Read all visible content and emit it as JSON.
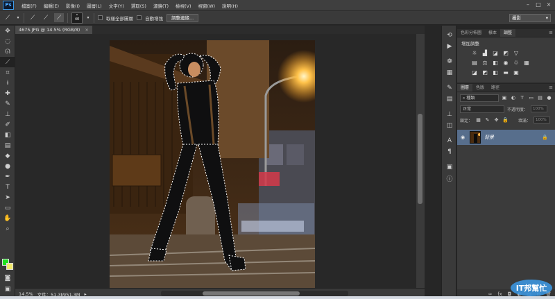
{
  "app": {
    "logo": "Ps"
  },
  "menu": [
    "檔案(F)",
    "編輯(E)",
    "影像(I)",
    "圖層(L)",
    "文字(Y)",
    "選取(S)",
    "濾鏡(T)",
    "檢視(V)",
    "視窗(W)",
    "說明(H)"
  ],
  "options": {
    "brush_size": "40",
    "sample_all_label": "取樣全部圖層",
    "auto_enhance_label": "自動增強",
    "refine_edge_button": "調整邊緣...",
    "workspace": "攝影"
  },
  "document": {
    "tab_title": "4675.JPG @ 14.5% (RGB/8)",
    "tab_close": "×",
    "zoom": "14.5%",
    "status": "文件：51.3M/51.3M"
  },
  "adjustments_panel": {
    "tabs": [
      "色彩分佈圖",
      "樣本",
      "調整"
    ],
    "active_tab": "調整",
    "title": "增加調整"
  },
  "layers_panel": {
    "tabs": [
      "圖層",
      "色版",
      "路徑"
    ],
    "active_tab": "圖層",
    "filter_kind": "種類",
    "blend_mode": "正常",
    "opacity_label": "不透明度：",
    "opacity_value": "100%",
    "lock_label": "鎖定：",
    "fill_label": "填滿：",
    "fill_value": "100%",
    "layers": [
      {
        "name": "背景",
        "visible": true,
        "locked": true
      }
    ]
  },
  "colors": {
    "foreground": "#1ee01e",
    "background": "#f0e86a",
    "selected_layer": "#576e8c"
  },
  "watermark": {
    "text": "IT邦幫忙"
  }
}
